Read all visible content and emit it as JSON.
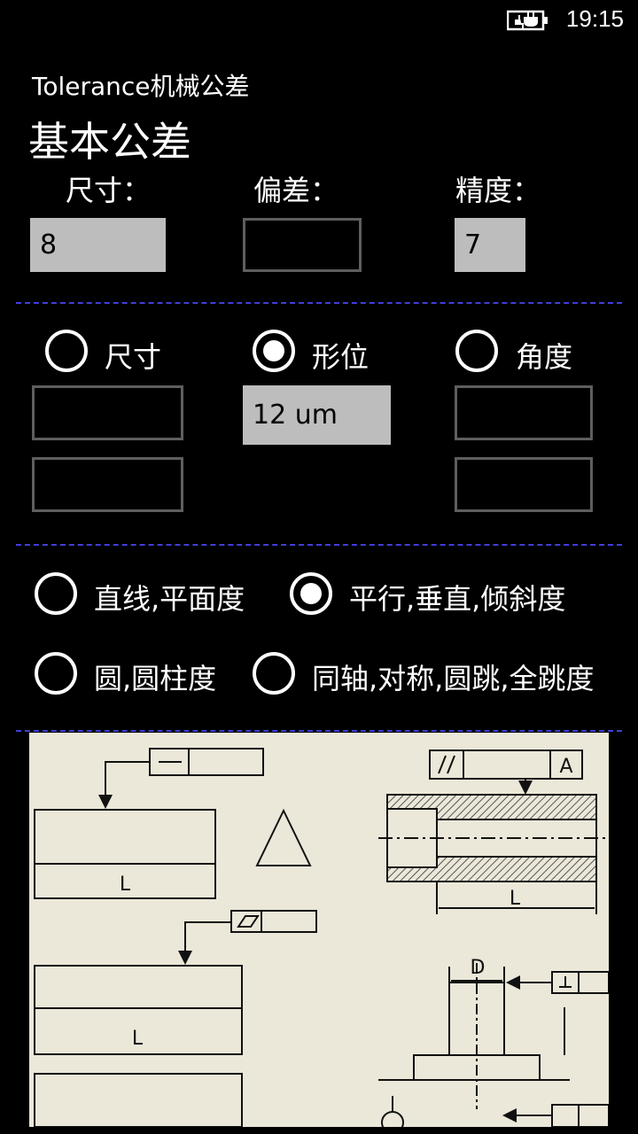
{
  "status": {
    "time": "19:15",
    "battery_icon": "battery-charging-icon"
  },
  "app": {
    "title": "Tolerance机械公差"
  },
  "page": {
    "title": "基本公差"
  },
  "fields": {
    "size_label": "尺寸：",
    "size_value": "8",
    "deviation_label": "偏差：",
    "deviation_value": "",
    "precision_label": "精度：",
    "precision_value": "7"
  },
  "mode": {
    "options": [
      {
        "label": "尺寸",
        "selected": false
      },
      {
        "label": "形位",
        "selected": true
      },
      {
        "label": "角度",
        "selected": false
      }
    ],
    "form_result": "12 um",
    "size_upper": "",
    "size_lower": "",
    "angle_upper": "",
    "angle_lower": ""
  },
  "tolerance_types": [
    {
      "label": "直线,平面度",
      "selected": false
    },
    {
      "label": "平行,垂直,倾斜度",
      "selected": true
    },
    {
      "label": "圆,圆柱度",
      "selected": false
    },
    {
      "label": "同轴,对称,圆跳,全跳度",
      "selected": false
    }
  ],
  "illustration": {
    "icon": "gdt-drawing-illustration",
    "letters": {
      "length": "L",
      "datum": "A",
      "diameter": "D"
    }
  },
  "colors": {
    "background": "#000000",
    "field_fill": "#bdbdbd",
    "divider": "#3f3fd8",
    "paper": "#ebe7d9"
  }
}
